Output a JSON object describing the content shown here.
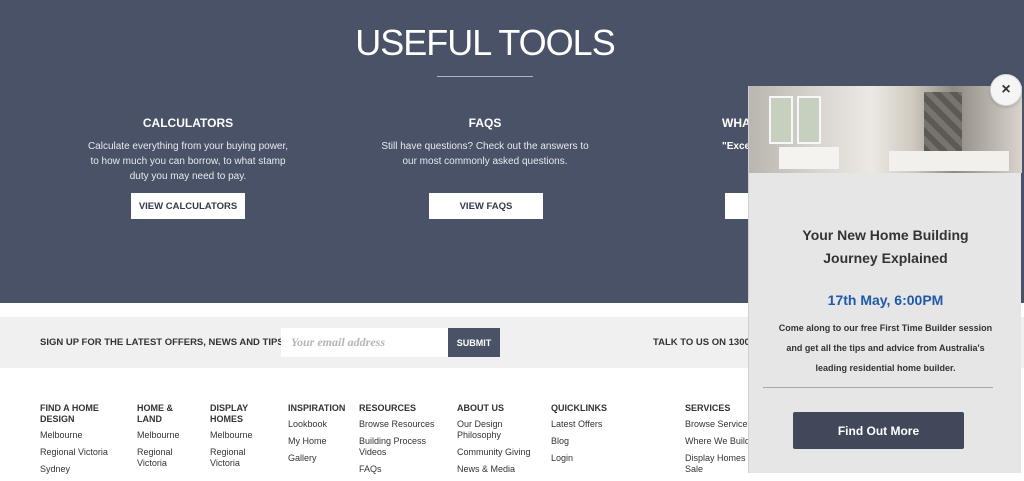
{
  "hero": {
    "title": "USEFUL TOOLS",
    "tools": [
      {
        "heading": "CALCULATORS",
        "text": "Calculate everything from your buying power, to how much you can borrow, to what stamp duty you may need to pay.",
        "button": "VIEW CALCULATORS"
      },
      {
        "heading": "FAQS",
        "text": "Still have questions? Check out the answers to our most commonly asked questions.",
        "button": "VIEW FAQS"
      },
      {
        "heading": "WHA",
        "text": "\"Exce",
        "button": ""
      }
    ]
  },
  "signup": {
    "label": "SIGN UP FOR THE LATEST OFFERS, NEWS AND TIPS",
    "email_placeholder": "Your email address",
    "submit": "SUBMIT",
    "talk": "TALK TO US ON 1300"
  },
  "footer": {
    "columns": [
      {
        "heading": "FIND A HOME DESIGN",
        "links": [
          "Melbourne",
          "Regional Victoria",
          "Sydney"
        ]
      },
      {
        "heading": "HOME & LAND",
        "links": [
          "Melbourne",
          "Regional Victoria"
        ]
      },
      {
        "heading": "DISPLAY HOMES",
        "links": [
          "Melbourne",
          "Regional Victoria"
        ]
      },
      {
        "heading": "INSPIRATION",
        "links": [
          "Lookbook",
          "My Home",
          "Gallery"
        ]
      },
      {
        "heading": "RESOURCES",
        "links": [
          "Browse Resources",
          "Building Process Videos",
          "FAQs"
        ]
      },
      {
        "heading": "ABOUT US",
        "links": [
          "Our Design Philosophy",
          "Community Giving",
          "News & Media"
        ]
      },
      {
        "heading": "QUICKLINKS",
        "links": [
          "Latest Offers",
          "Blog",
          "Login"
        ]
      },
      {
        "heading": "SERVICES",
        "links": [
          "Browse Services",
          "Where We Build",
          "Display Homes Sale"
        ]
      }
    ]
  },
  "popup": {
    "close": "×",
    "title_line1": "Your New Home Building",
    "title_line2": "Journey Explained",
    "date": "17th May, 6:00PM",
    "desc_line1": "Come along to our free First Time Builder session",
    "desc_line2": "and get all the tips and advice from Australia's",
    "desc_line3": "leading residential home builder.",
    "button": "Find Out More"
  }
}
